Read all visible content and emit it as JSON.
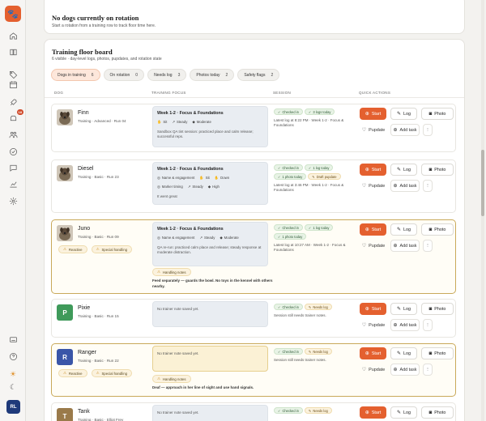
{
  "sidebar": {
    "brand_icon": "paw-icon",
    "nav": [
      {
        "name": "home-icon"
      },
      {
        "name": "book-icon"
      },
      {
        "name": "tag-icon"
      },
      {
        "name": "calendar-icon"
      },
      {
        "name": "rocket-icon"
      },
      {
        "name": "dog-icon",
        "badge": "18"
      },
      {
        "name": "people-icon"
      },
      {
        "name": "check-circle-icon"
      },
      {
        "name": "chat-icon"
      },
      {
        "name": "chart-icon"
      },
      {
        "name": "gear-icon"
      }
    ],
    "bottom": [
      {
        "name": "keyboard-icon"
      },
      {
        "name": "help-icon"
      },
      {
        "name": "sun-icon"
      },
      {
        "name": "moon-icon"
      }
    ],
    "user_initials": "RL"
  },
  "rotation": {
    "title": "No dogs currently on rotation",
    "subtitle": "Start a rotation from a training row to track floor time here."
  },
  "board": {
    "title": "Training floor board",
    "subtitle": "6 visible · day-level logs, photos, pupdates, and rotation state",
    "filters": [
      {
        "label": "Dogs in training",
        "count": "6",
        "active": true
      },
      {
        "label": "On rotation",
        "count": "0",
        "active": false
      },
      {
        "label": "Needs log",
        "count": "3",
        "active": false
      },
      {
        "label": "Photos today",
        "count": "2",
        "active": false
      },
      {
        "label": "Safety flags",
        "count": "2",
        "active": false
      }
    ],
    "columns": {
      "dog": "DOG",
      "focus": "TRAINING FOCUS",
      "session": "SESSION",
      "actions": "QUICK ACTIONS"
    },
    "action_labels": {
      "start": "Start",
      "log": "Log",
      "photo": "Photo",
      "pupdate": "Pupdate",
      "add_task": "Add task",
      "more": "⋮"
    },
    "rows": [
      {
        "name": "Finn",
        "meta": "Training · Advanced · Run 04",
        "photo": true,
        "tags": [],
        "focus": {
          "title": "Week 1-2 · Focus & Foundations",
          "chips": [
            {
              "icon": "✋",
              "label": "Sit"
            },
            {
              "icon": "↗",
              "label": "Steady"
            },
            {
              "icon": "◆",
              "label": "Moderate"
            }
          ],
          "note": "Sandbox QA tint session: practiced place and calm release; successful reps."
        },
        "session": {
          "pills": [
            {
              "label": "Checked in",
              "warn": false
            },
            {
              "label": "3 logs today",
              "warn": false
            }
          ],
          "log": "Latest log at 8:22 PM · Week 1-2 · Focus & Foundations"
        }
      },
      {
        "name": "Diesel",
        "meta": "Training · Basic · Run 23",
        "photo": true,
        "tags": [],
        "focus": {
          "title": "Week 1-2 · Focus & Foundations",
          "chips": [
            {
              "icon": "◎",
              "label": "Name & engagement"
            },
            {
              "icon": "✋",
              "label": "Sit"
            },
            {
              "icon": "✋",
              "label": "Down"
            },
            {
              "icon": "◎",
              "label": "Marker timing"
            },
            {
              "icon": "↗",
              "label": "Steady"
            },
            {
              "icon": "◆",
              "label": "High"
            }
          ],
          "note": "It went great"
        },
        "session": {
          "pills": [
            {
              "label": "Checked in",
              "warn": false
            },
            {
              "label": "1 log today",
              "warn": false
            },
            {
              "label": "1 photo today",
              "warn": false
            },
            {
              "label": "Draft pupdate",
              "warn": true
            }
          ],
          "log": "Latest log at 3:46 PM · Week 1-2 · Focus & Foundations"
        }
      },
      {
        "name": "Juno",
        "meta": "Training · Basic · Run 09",
        "photo": true,
        "tags": [
          {
            "label": "Reactive"
          },
          {
            "label": "Special handling"
          }
        ],
        "focus": {
          "title": "Week 1-2 · Focus & Foundations",
          "chips": [
            {
              "icon": "◎",
              "label": "Name & engagement"
            },
            {
              "icon": "↗",
              "label": "Steady"
            },
            {
              "icon": "◆",
              "label": "Moderate"
            }
          ],
          "note": "QA re-run: practiced calm place and release; steady response at moderate distraction."
        },
        "handling_label": "Handling notes",
        "handling_note": "Feed separately — guards the bowl. No toys in the kennel with others nearby.",
        "session": {
          "pills": [
            {
              "label": "Checked in",
              "warn": false
            },
            {
              "label": "1 log today",
              "warn": false
            },
            {
              "label": "1 photo today",
              "warn": false
            }
          ],
          "log": "Latest log at 10:27 AM · Week 1-2 · Focus & Foundations"
        }
      },
      {
        "name": "Pixie",
        "meta": "Training · Basic · Run 15",
        "initial": "P",
        "color": "#3f9a5a",
        "tags": [],
        "focus": {
          "empty": "No trainer note saved yet."
        },
        "session": {
          "pills": [
            {
              "label": "Checked in",
              "warn": false
            },
            {
              "label": "Needs log",
              "warn": true
            }
          ],
          "log": "Session still needs trainer notes."
        }
      },
      {
        "name": "Ranger",
        "meta": "Training · Basic · Run 22",
        "initial": "R",
        "color": "#3a56a8",
        "tags": [
          {
            "label": "Reactive"
          },
          {
            "label": "Special handling"
          }
        ],
        "focus": {
          "empty": "No trainer note saved yet."
        },
        "handling_label": "Handling notes",
        "handling_note": "Deaf — approach in her line of sight and use hand signals.",
        "session": {
          "pills": [
            {
              "label": "Checked in",
              "warn": false
            },
            {
              "label": "Needs log",
              "warn": true
            }
          ],
          "log": "Session still needs trainer notes."
        }
      },
      {
        "name": "Tank",
        "meta": "Training · Basic · Elliot Frey",
        "initial": "T",
        "color": "#9a7a4a",
        "tags": [],
        "focus": {
          "empty": "No trainer note saved yet."
        },
        "session": {
          "pills": [
            {
              "label": "Checked in",
              "warn": false
            },
            {
              "label": "Needs log",
              "warn": true
            }
          ],
          "log": ""
        }
      }
    ]
  }
}
